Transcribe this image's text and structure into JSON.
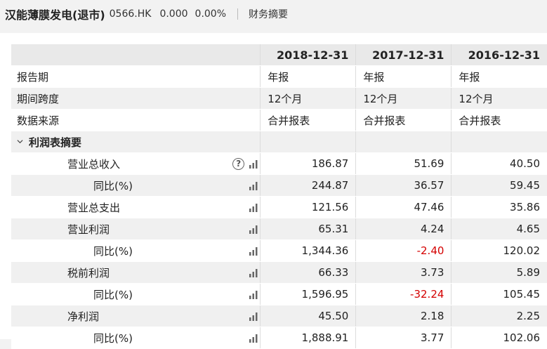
{
  "header": {
    "company": "汉能薄膜发电(退市)",
    "code": "0566.HK",
    "price": "0.000",
    "change_pct": "0.00%",
    "section": "财务摘要"
  },
  "columns": [
    "2018-12-31",
    "2017-12-31",
    "2016-12-31"
  ],
  "meta_rows": [
    {
      "label": "报告期",
      "values": [
        "年报",
        "年报",
        "年报"
      ]
    },
    {
      "label": "期间跨度",
      "values": [
        "12个月",
        "12个月",
        "12个月"
      ]
    },
    {
      "label": "数据来源",
      "values": [
        "合并报表",
        "合并报表",
        "合并报表"
      ]
    }
  ],
  "section": {
    "label": "利润表摘要"
  },
  "data_rows": [
    {
      "label": "营业总收入",
      "values": [
        "186.87",
        "51.69",
        "40.50"
      ]
    },
    {
      "label": "同比(%)",
      "values": [
        "244.87",
        "36.57",
        "59.45"
      ]
    },
    {
      "label": "营业总支出",
      "values": [
        "121.56",
        "47.46",
        "35.86"
      ]
    },
    {
      "label": "营业利润",
      "values": [
        "65.31",
        "4.24",
        "4.65"
      ]
    },
    {
      "label": "同比(%)",
      "values": [
        "1,344.36",
        "-2.40",
        "120.02"
      ]
    },
    {
      "label": "税前利润",
      "values": [
        "66.33",
        "3.73",
        "5.89"
      ]
    },
    {
      "label": "同比(%)",
      "values": [
        "1,596.95",
        "-32.24",
        "105.45"
      ]
    },
    {
      "label": "净利润",
      "values": [
        "45.50",
        "2.18",
        "2.25"
      ]
    },
    {
      "label": "同比(%)",
      "values": [
        "1,888.91",
        "3.77",
        "102.06"
      ]
    }
  ],
  "icons": {
    "help": "question-circle-icon",
    "bars": "bar-chart-icon"
  },
  "help_glyph": "?",
  "colors": {
    "negative": "#d40000",
    "header_bg": "#e9e9e9",
    "alt_row": "#f0f0f0"
  }
}
